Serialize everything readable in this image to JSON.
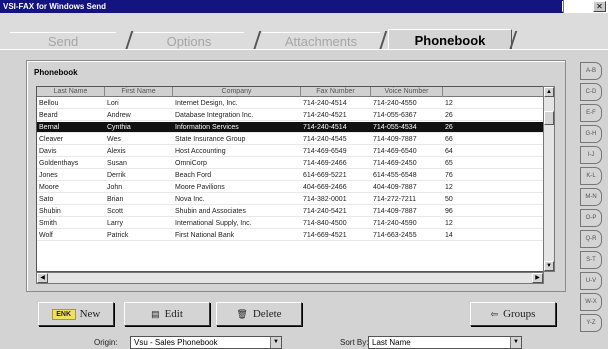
{
  "window": {
    "title": "VSI-FAX for Windows Send"
  },
  "tabs": [
    {
      "label": "Send"
    },
    {
      "label": "Options"
    },
    {
      "label": "Attachments"
    },
    {
      "label": "Phonebook"
    }
  ],
  "phonebook": {
    "group_label": "Phonebook",
    "columns": [
      "Last Name",
      "First Name",
      "Company",
      "Fax Number",
      "Voice Number",
      ""
    ],
    "rows": [
      {
        "last": "Bellou",
        "first": "Lori",
        "company": "Internet Design, Inc.",
        "fax": "714-240-4514",
        "voice": "714-240-4550",
        "extra": "12"
      },
      {
        "last": "Beard",
        "first": "Andrew",
        "company": "Database Integration Inc.",
        "fax": "714-240-4521",
        "voice": "714-055-6367",
        "extra": "26"
      },
      {
        "last": "Bernal",
        "first": "Cynthia",
        "company": "Information Services",
        "fax": "714-240-4514",
        "voice": "714-055-4534",
        "extra": "26",
        "selected": true
      },
      {
        "last": "Cleaver",
        "first": "Wes",
        "company": "State Insurance Group",
        "fax": "714-240-4545",
        "voice": "714-409-7887",
        "extra": "66"
      },
      {
        "last": "Davis",
        "first": "Alexis",
        "company": "Host Accounting",
        "fax": "714-469-6549",
        "voice": "714-469-6540",
        "extra": "64"
      },
      {
        "last": "Goldenthays",
        "first": "Susan",
        "company": "OmniCorp",
        "fax": "714-469-2466",
        "voice": "714-469-2450",
        "extra": "65"
      },
      {
        "last": "Jones",
        "first": "Derrik",
        "company": "Beach Ford",
        "fax": "614-669-5221",
        "voice": "614-455-6548",
        "extra": "76"
      },
      {
        "last": "Moore",
        "first": "John",
        "company": "Moore Pavilions",
        "fax": "404-669-2466",
        "voice": "404-409-7887",
        "extra": "12"
      },
      {
        "last": "Sato",
        "first": "Brian",
        "company": "Nova Inc.",
        "fax": "714-382-0001",
        "voice": "714-272-7211",
        "extra": "50"
      },
      {
        "last": "Shubin",
        "first": "Scott",
        "company": "Shubin and Associates",
        "fax": "714-240-5421",
        "voice": "714-409-7887",
        "extra": "96"
      },
      {
        "last": "Smith",
        "first": "Larry",
        "company": "International Supply, Inc.",
        "fax": "714-840-4500",
        "voice": "714-240-4590",
        "extra": "12"
      },
      {
        "last": "Wolf",
        "first": "Patrick",
        "company": "First National Bank",
        "fax": "714-669-4521",
        "voice": "714-663-2455",
        "extra": "14"
      }
    ]
  },
  "buttons": {
    "new": {
      "label": "New",
      "icon_text": "ENK"
    },
    "edit": {
      "label": "Edit"
    },
    "delete": {
      "label": "Delete"
    },
    "groups": {
      "label": "Groups"
    }
  },
  "bottom": {
    "origin_label": "Origin:",
    "origin_value": "Vsu - Sales Phonebook",
    "sort_label": "Sort By:",
    "sort_value": "Last Name"
  },
  "alpha_tabs": [
    "A-B",
    "C-D",
    "E-F",
    "G-H",
    "I-J",
    "K-L",
    "M-N",
    "O-P",
    "Q-R",
    "S-T",
    "U-V",
    "W-X",
    "Y-Z"
  ],
  "colors": {
    "titlebar": "#13147f",
    "selection": "#111111",
    "face": "#d3d3d3"
  }
}
